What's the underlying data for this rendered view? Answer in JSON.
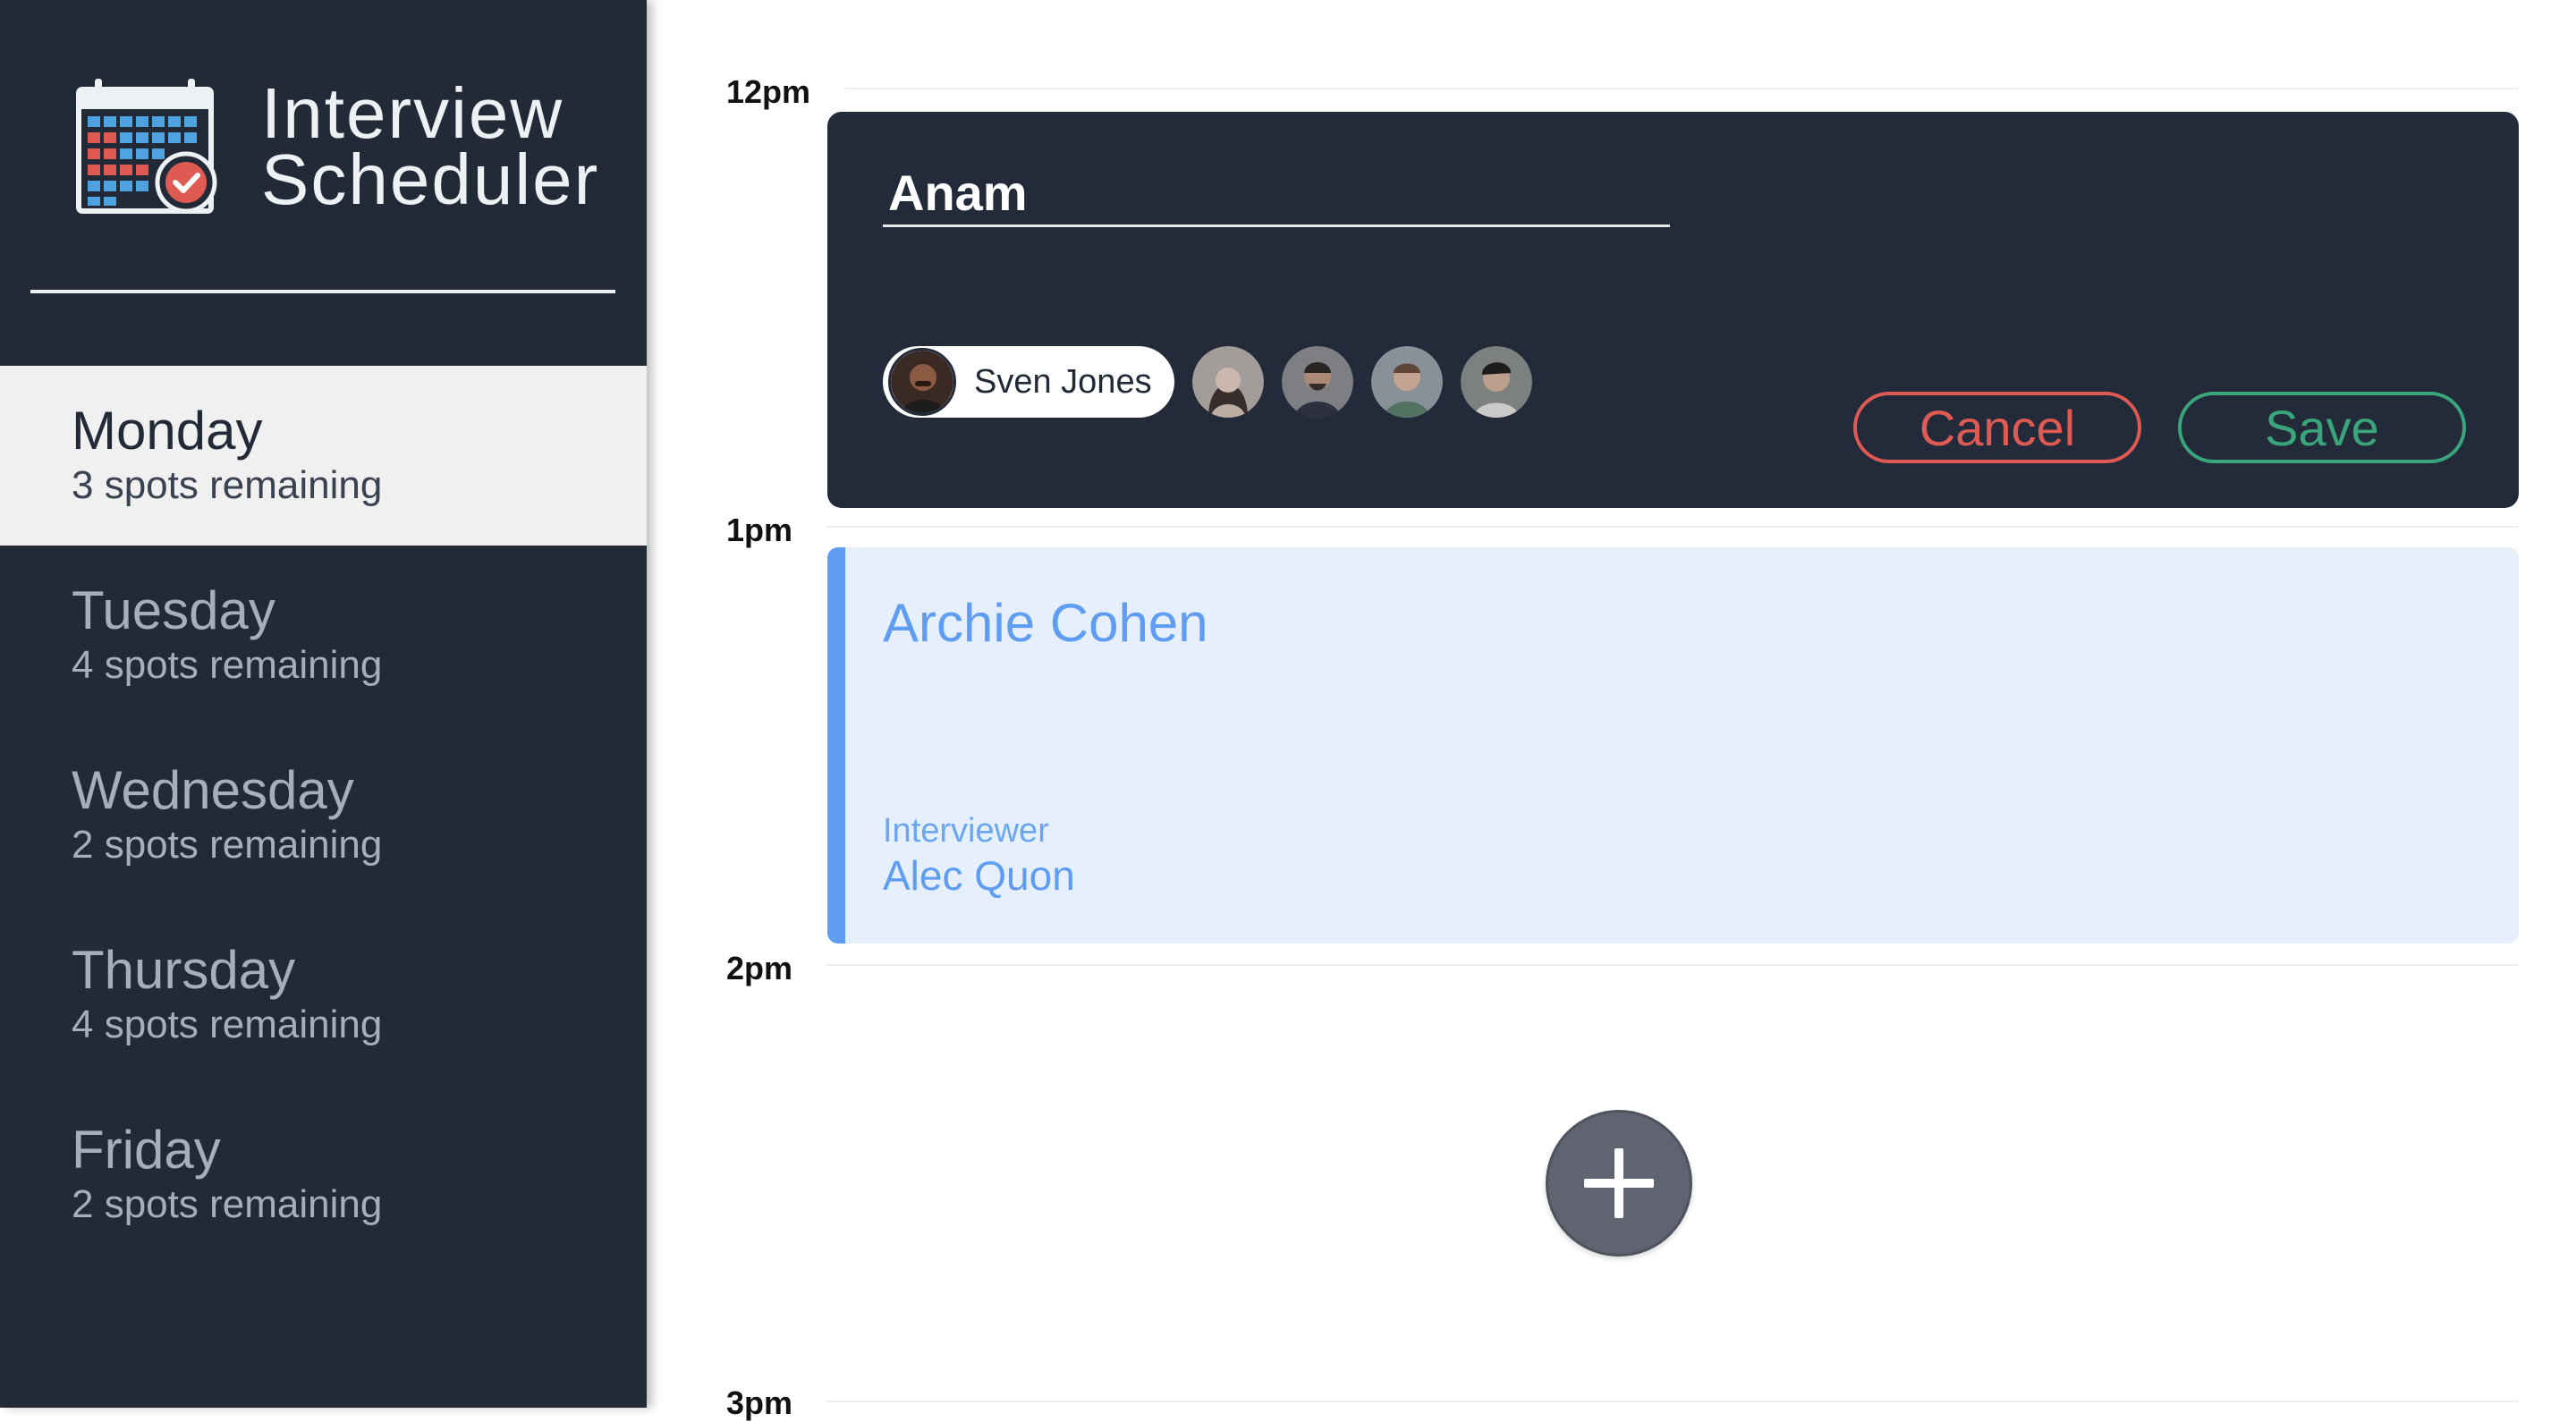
{
  "app": {
    "title_line1": "Interview",
    "title_line2": "Scheduler",
    "logo_icon": "calendar-check-icon"
  },
  "days": [
    {
      "name": "Monday",
      "spots": "3 spots remaining",
      "selected": true
    },
    {
      "name": "Tuesday",
      "spots": "4 spots remaining",
      "selected": false
    },
    {
      "name": "Wednesday",
      "spots": "2 spots remaining",
      "selected": false
    },
    {
      "name": "Thursday",
      "spots": "4 spots remaining",
      "selected": false
    },
    {
      "name": "Friday",
      "spots": "2 spots remaining",
      "selected": false
    }
  ],
  "schedule": {
    "times": [
      "12pm",
      "1pm",
      "2pm",
      "3pm"
    ]
  },
  "edit_form": {
    "student_value": "Anam",
    "selected_interviewer": "Sven Jones",
    "other_interviewer_count": 4,
    "cancel_label": "Cancel",
    "save_label": "Save"
  },
  "booked": {
    "student": "Archie Cohen",
    "interviewer_label": "Interviewer",
    "interviewer": "Alec Quon"
  },
  "add_button": {
    "icon": "plus-icon"
  },
  "colors": {
    "sidebar_bg": "#222a38",
    "selected_day_bg": "#f0f0f0",
    "cancel": "#e05a54",
    "save": "#3aa57a",
    "booked_accent": "#5e9df2",
    "booked_bg": "#e6f0fd"
  }
}
